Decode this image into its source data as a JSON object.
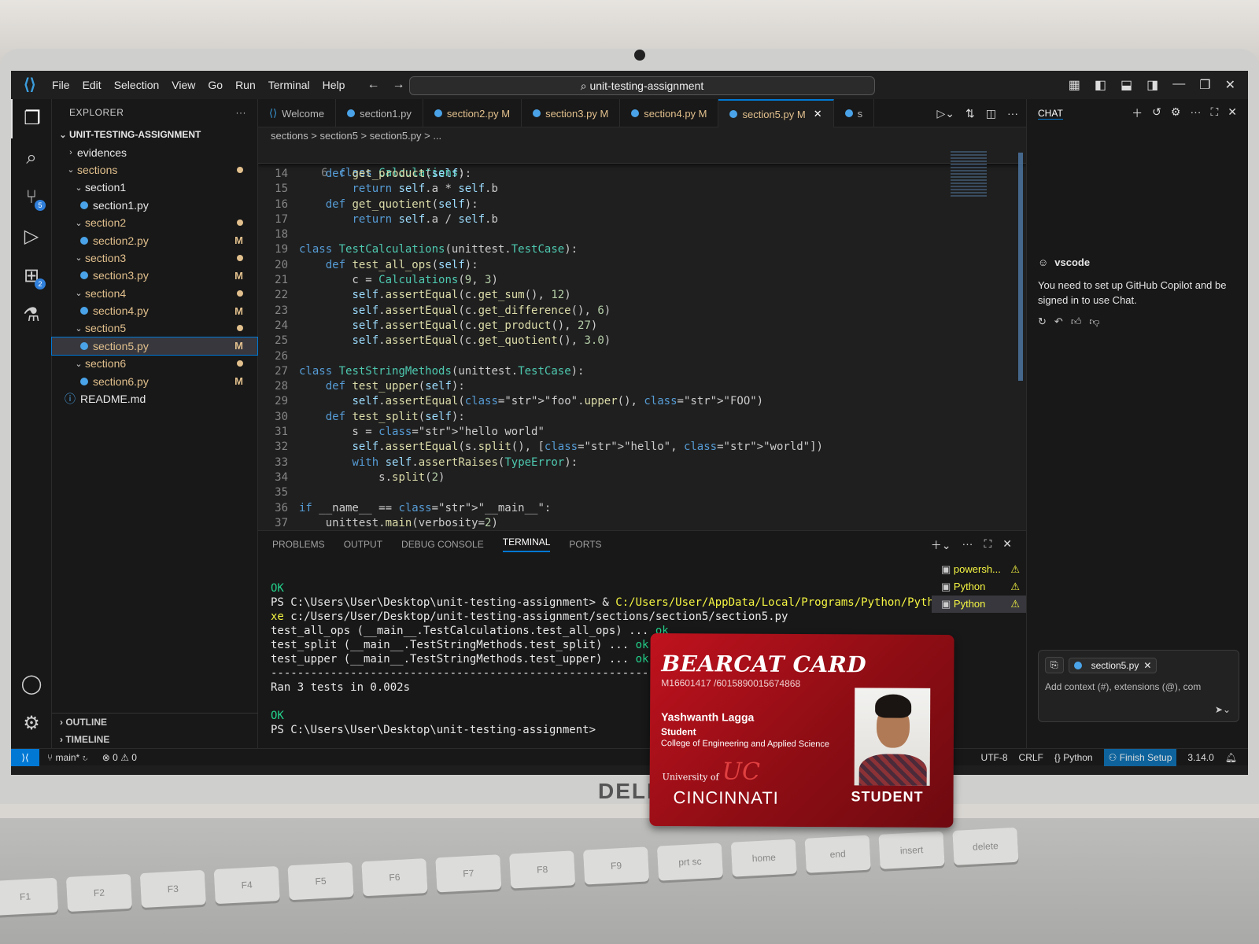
{
  "window": {
    "search": "unit-testing-assignment",
    "menu": [
      "File",
      "Edit",
      "Selection",
      "View",
      "Go",
      "Run",
      "Terminal",
      "Help"
    ]
  },
  "explorer": {
    "title": "EXPLORER",
    "root": "UNIT-TESTING-ASSIGNMENT",
    "items": [
      {
        "label": "evidences",
        "indent": 1,
        "kind": "folder-closed",
        "tag": ""
      },
      {
        "label": "sections",
        "indent": 1,
        "kind": "folder-open",
        "tag": "dot"
      },
      {
        "label": "section1",
        "indent": 2,
        "kind": "folder-open",
        "tag": ""
      },
      {
        "label": "section1.py",
        "indent": 3,
        "kind": "file",
        "tag": ""
      },
      {
        "label": "section2",
        "indent": 2,
        "kind": "folder-open",
        "tag": "dot"
      },
      {
        "label": "section2.py",
        "indent": 3,
        "kind": "file",
        "tag": "M"
      },
      {
        "label": "section3",
        "indent": 2,
        "kind": "folder-open",
        "tag": "dot"
      },
      {
        "label": "section3.py",
        "indent": 3,
        "kind": "file",
        "tag": "M"
      },
      {
        "label": "section4",
        "indent": 2,
        "kind": "folder-open",
        "tag": "dot"
      },
      {
        "label": "section4.py",
        "indent": 3,
        "kind": "file",
        "tag": "M"
      },
      {
        "label": "section5",
        "indent": 2,
        "kind": "folder-open",
        "tag": "dot"
      },
      {
        "label": "section5.py",
        "indent": 3,
        "kind": "file",
        "tag": "M",
        "selected": true
      },
      {
        "label": "section6",
        "indent": 2,
        "kind": "folder-open",
        "tag": "dot"
      },
      {
        "label": "section6.py",
        "indent": 3,
        "kind": "file",
        "tag": "M"
      },
      {
        "label": "README.md",
        "indent": 1,
        "kind": "info",
        "tag": ""
      }
    ],
    "outline": "OUTLINE",
    "timeline": "TIMELINE"
  },
  "tabs": [
    {
      "label": "Welcome",
      "modified": false,
      "active": false
    },
    {
      "label": "section1.py",
      "modified": false,
      "active": false
    },
    {
      "label": "section2.py M",
      "modified": true,
      "active": false
    },
    {
      "label": "section3.py M",
      "modified": true,
      "active": false
    },
    {
      "label": "section4.py M",
      "modified": true,
      "active": false
    },
    {
      "label": "section5.py M",
      "modified": true,
      "active": true
    },
    {
      "label": "s",
      "modified": false,
      "active": false
    }
  ],
  "breadcrumb": "sections > section5 > section5.py > ...",
  "editor": {
    "sticky_line": "6",
    "sticky_text": "class Calculations:",
    "lines": [
      {
        "n": "14",
        "t": "    def get_product(self):"
      },
      {
        "n": "15",
        "t": "        return self.a * self.b"
      },
      {
        "n": "16",
        "t": "    def get_quotient(self):"
      },
      {
        "n": "17",
        "t": "        return self.a / self.b"
      },
      {
        "n": "18",
        "t": ""
      },
      {
        "n": "19",
        "t": "class TestCalculations(unittest.TestCase):"
      },
      {
        "n": "20",
        "t": "    def test_all_ops(self):"
      },
      {
        "n": "21",
        "t": "        c = Calculations(9, 3)"
      },
      {
        "n": "22",
        "t": "        self.assertEqual(c.get_sum(), 12)"
      },
      {
        "n": "23",
        "t": "        self.assertEqual(c.get_difference(), 6)"
      },
      {
        "n": "24",
        "t": "        self.assertEqual(c.get_product(), 27)"
      },
      {
        "n": "25",
        "t": "        self.assertEqual(c.get_quotient(), 3.0)"
      },
      {
        "n": "26",
        "t": ""
      },
      {
        "n": "27",
        "t": "class TestStringMethods(unittest.TestCase):"
      },
      {
        "n": "28",
        "t": "    def test_upper(self):"
      },
      {
        "n": "29",
        "t": "        self.assertEqual(\"foo\".upper(), \"FOO\")"
      },
      {
        "n": "30",
        "t": "    def test_split(self):"
      },
      {
        "n": "31",
        "t": "        s = \"hello world\""
      },
      {
        "n": "32",
        "t": "        self.assertEqual(s.split(), [\"hello\", \"world\"])"
      },
      {
        "n": "33",
        "t": "        with self.assertRaises(TypeError):"
      },
      {
        "n": "34",
        "t": "            s.split(2)"
      },
      {
        "n": "35",
        "t": ""
      },
      {
        "n": "36",
        "t": "if __name__ == \"__main__\":"
      },
      {
        "n": "37",
        "t": "    unittest.main(verbosity=2)"
      }
    ]
  },
  "panel": {
    "tabs": [
      "PROBLEMS",
      "OUTPUT",
      "DEBUG CONSOLE",
      "TERMINAL",
      "PORTS"
    ],
    "active_tab": "TERMINAL",
    "terminal": {
      "ok1": "OK",
      "prompt1": "PS C:\\Users\\User\\Desktop\\unit-testing-assignment> & ",
      "python_path": "C:/Users/User/AppData/Local/Programs/Python/Python314/python.e",
      "python_path2": "xe",
      "script_path": " c:/Users/User/Desktop/unit-testing-assignment/sections/section5/section5.py",
      "tests": [
        {
          "name": "test_all_ops (__main__.TestCalculations.test_all_ops) ... ",
          "result": "ok"
        },
        {
          "name": "test_split (__main__.TestStringMethods.test_split) ... ",
          "result": "ok"
        },
        {
          "name": "test_upper (__main__.TestStringMethods.test_upper) ... ",
          "result": "ok"
        }
      ],
      "separator": "----------------------------------------------------------------------",
      "ran": "Ran 3 tests in 0.002s",
      "ok2": "OK",
      "prompt2": "PS C:\\Users\\User\\Desktop\\unit-testing-assignment>"
    },
    "instances": [
      "powersh...",
      "Python",
      "Python"
    ]
  },
  "chat": {
    "title": "CHAT",
    "sender": "vscode",
    "message": "You need to set up GitHub Copilot and be signed in to use Chat.",
    "attachment": "section5.py",
    "placeholder": "Add context (#), extensions (@), com"
  },
  "statusbar": {
    "branch": "main*",
    "errors": "0",
    "warnings": "0",
    "encoding": "UTF-8",
    "eol": "CRLF",
    "language": "Python",
    "finish_setup": "Finish Setup",
    "version": "3.14.0"
  },
  "id_card": {
    "title": "BEARCAT CARD",
    "number": "M16601417 /6015890015674868",
    "name": "Yashwanth Lagga",
    "role": "Student",
    "college": "College of Engineering and Applied Science",
    "university_prefix": "University of",
    "university": "CINCINNATI",
    "badge": "STUDENT"
  },
  "laptop": {
    "brand": "DELL",
    "keys": [
      "F1",
      "F2",
      "F3",
      "F4",
      "F5",
      "F6",
      "F7",
      "F8",
      "F9",
      "prt sc",
      "home",
      "end",
      "insert",
      "delete"
    ]
  }
}
